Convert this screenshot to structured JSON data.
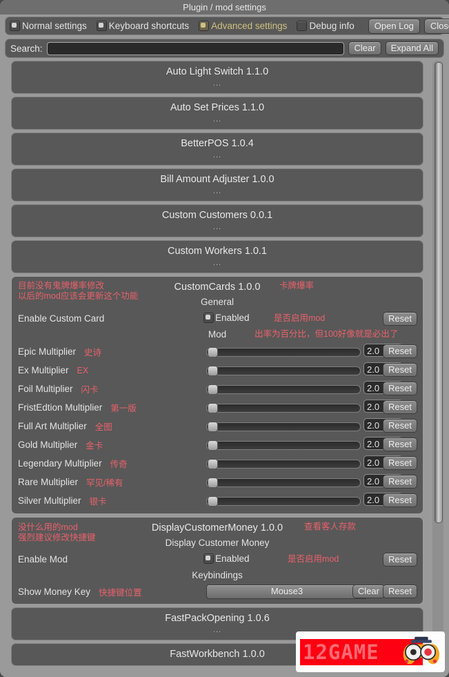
{
  "window": {
    "title": "Plugin / mod settings"
  },
  "toolbar": {
    "tabs": [
      {
        "label": "Normal settings",
        "selected": false,
        "accent": false
      },
      {
        "label": "Keyboard shortcuts",
        "selected": false,
        "accent": false
      },
      {
        "label": "Advanced settings",
        "selected": true,
        "accent": true
      },
      {
        "label": "Debug info",
        "selected": false,
        "accent": false
      }
    ],
    "open_log_label": "Open Log",
    "close_label": "Close"
  },
  "search": {
    "label": "Search:",
    "value": "",
    "placeholder": "",
    "clear_label": "Clear",
    "expand_all_label": "Expand All"
  },
  "colors": {
    "annotation_red": "#e8616b",
    "accent_tab": "#cfc07f",
    "panel_bg": "#585858",
    "window_bg": "#9a9a9a"
  },
  "collapsed_mods": [
    {
      "title": "Auto Light Switch 1.1.0",
      "dots": "..."
    },
    {
      "title": "Auto Set Prices 1.1.0",
      "dots": "..."
    },
    {
      "title": "BetterPOS 1.0.4",
      "dots": "..."
    },
    {
      "title": "Bill Amount Adjuster 1.0.0",
      "dots": "..."
    },
    {
      "title": "Custom Customers 0.0.1",
      "dots": "..."
    },
    {
      "title": "Custom Workers 1.0.1",
      "dots": "..."
    }
  ],
  "custom_cards": {
    "title": "CustomCards 1.0.0",
    "title_annotation": "卡牌爆率",
    "left_annotation": "目前没有鬼牌爆率修改\n以后的mod应该会更新这个功能",
    "general_header": "General",
    "enable_row": {
      "label": "Enable Custom Card",
      "checkbox_label": "Enabled",
      "checked": true,
      "annotation": "是否启用mod",
      "reset_label": "Reset"
    },
    "mod_header": "Mod",
    "mod_header_annotation": "出率为百分比，但100好像就是必出了",
    "sliders": [
      {
        "label": "Epic Multiplier",
        "annotation": "史诗",
        "value": "2.0",
        "fill": 0,
        "reset_label": "Reset"
      },
      {
        "label": "Ex Multiplier",
        "annotation": "EX",
        "value": "2.0",
        "fill": 0,
        "reset_label": "Reset"
      },
      {
        "label": "Foil Multiplier",
        "annotation": "闪卡",
        "value": "2.0",
        "fill": 0,
        "reset_label": "Reset"
      },
      {
        "label": "FristEdtion Multiplier",
        "annotation": "第一版",
        "value": "2.0",
        "fill": 0,
        "reset_label": "Reset"
      },
      {
        "label": "Full Art  Multiplier",
        "annotation": "全图",
        "value": "2.0",
        "fill": 0,
        "reset_label": "Reset"
      },
      {
        "label": "Gold Multiplier",
        "annotation": "金卡",
        "value": "2.0",
        "fill": 0,
        "reset_label": "Reset"
      },
      {
        "label": "Legendary Multiplier",
        "annotation": "传奇",
        "value": "2.0",
        "fill": 0,
        "reset_label": "Reset"
      },
      {
        "label": "Rare Multiplier",
        "annotation": "罕见/稀有",
        "value": "2.0",
        "fill": 0,
        "reset_label": "Reset"
      },
      {
        "label": "Silver Multiplier",
        "annotation": "银卡",
        "value": "2.0",
        "fill": 0,
        "reset_label": "Reset"
      }
    ]
  },
  "display_customer_money": {
    "title": "DisplayCustomerMoney 1.0.0",
    "title_annotation": "查看客人存款",
    "left_annotation": "没什么用的mod\n强烈建议修改快捷键",
    "sub_header": "Display Customer Money",
    "enable_row": {
      "label": "Enable Mod",
      "checkbox_label": "Enabled",
      "checked": true,
      "annotation": "是否启用mod",
      "reset_label": "Reset"
    },
    "keybindings_header": "Keybindings",
    "key_row": {
      "label": "Show Money Key",
      "annotation": "快捷键位置",
      "key_value": "Mouse3",
      "clear_label": "Clear",
      "reset_label": "Reset"
    }
  },
  "bottom_mods": [
    {
      "title": "FastPackOpening 1.0.6",
      "dots": "..."
    },
    {
      "title": "FastWorkbench 1.0.0",
      "dots": ""
    }
  ],
  "watermark": {
    "text": "12GAME"
  }
}
